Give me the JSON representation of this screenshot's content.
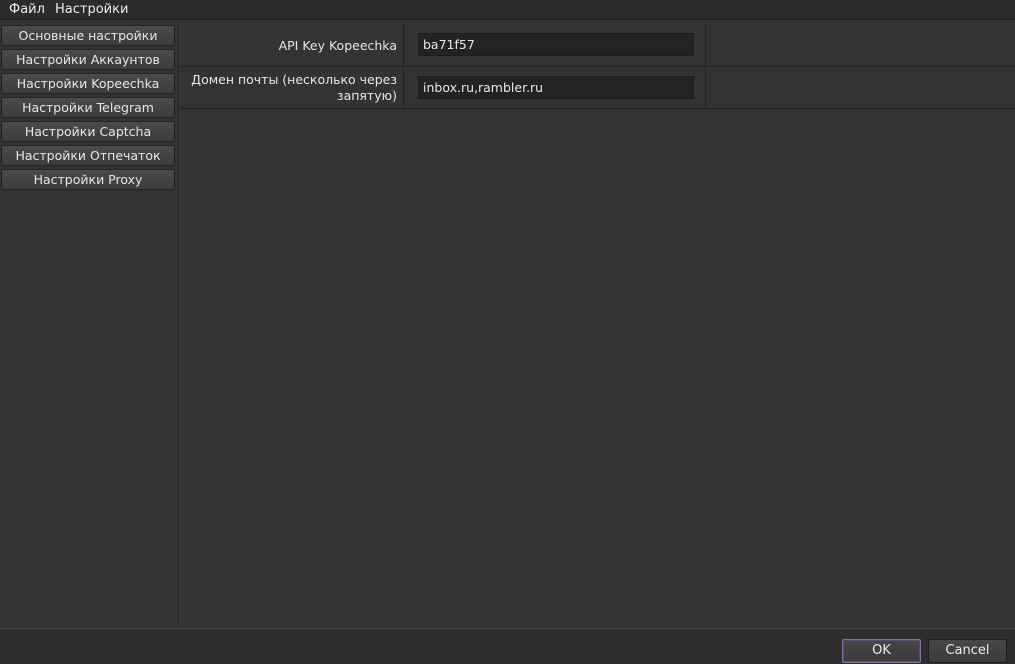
{
  "menubar": {
    "items": [
      {
        "label": "Файл"
      },
      {
        "label": "Настройки"
      }
    ]
  },
  "sidebar": {
    "items": [
      {
        "label": "Основные настройки"
      },
      {
        "label": "Настройки Аккаунтов"
      },
      {
        "label": "Настройки Kopeechka"
      },
      {
        "label": "Настройки Telegram"
      },
      {
        "label": "Настройки Captcha"
      },
      {
        "label": "Настройки Отпечаток"
      },
      {
        "label": "Настройки Proxy"
      }
    ]
  },
  "settings": {
    "rows": [
      {
        "label": "API Key Kopeechka",
        "value": "ba71f57"
      },
      {
        "label_line1": "Домен почты (несколько через",
        "label_line2": "запятую)",
        "value": "inbox.ru,rambler.ru"
      }
    ]
  },
  "footer": {
    "ok_label": "OK",
    "cancel_label": "Cancel"
  },
  "colors": {
    "background": "#333333",
    "field_background": "#232323",
    "ok_border_accent": "#8c6ca8"
  }
}
